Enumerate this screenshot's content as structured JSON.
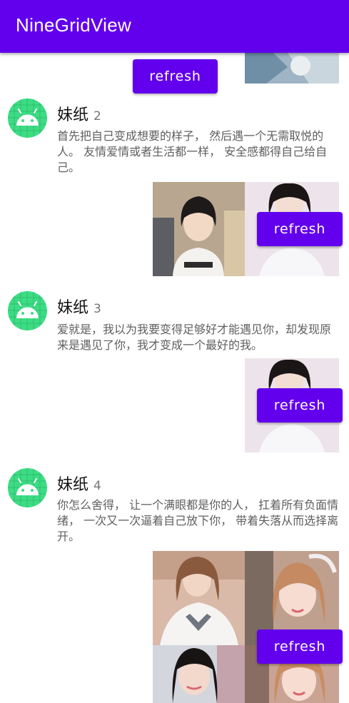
{
  "appbar": {
    "title": "NineGridView"
  },
  "top": {
    "refresh_label": "refresh"
  },
  "posts": [
    {
      "name": "妹纸",
      "index": "2",
      "text": "首先把自己变成想要的样子， 然后遇一个无需取悦的人。 友情爱情或者生活都一样， 安全感都得自己给自己。",
      "refresh_label": "refresh"
    },
    {
      "name": "妹纸",
      "index": "3",
      "text": "爱就是，我以为我要变得足够好才能遇见你，却发现原来是遇见了你，我才变成一个最好的我。",
      "refresh_label": "refresh"
    },
    {
      "name": "妹纸",
      "index": "4",
      "text": "你怎么舍得， 让一个满眼都是你的人， 扛着所有负面情绪， 一次又一次逼着自己放下你， 带着失落从而选择离开。",
      "refresh_label": "refresh"
    }
  ],
  "colors": {
    "primary": "#6200ee",
    "avatar_bg": "#3ddc84",
    "avatar_android": "#ffffff"
  },
  "icons": {
    "avatar": "android-avatar-icon"
  }
}
